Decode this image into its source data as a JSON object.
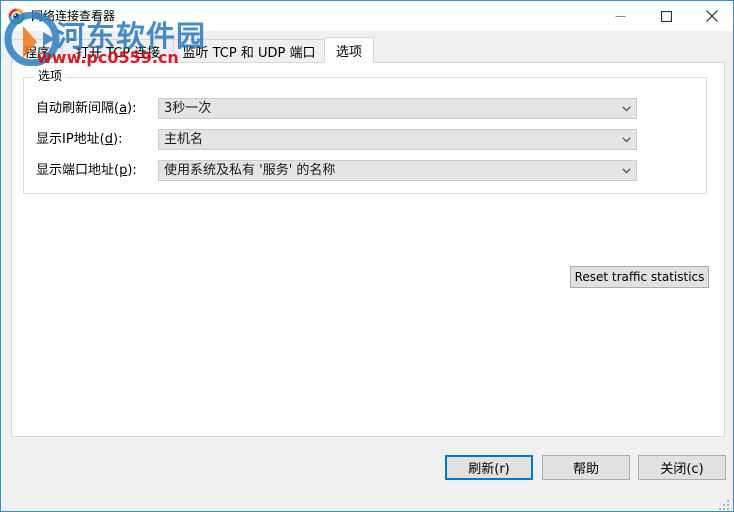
{
  "window": {
    "title": "网络连接查看器",
    "icon": "eye-globe-icon",
    "controls": {
      "minimize": "minimize-icon",
      "maximize": "maximize-icon",
      "close": "close-icon"
    },
    "accent_color": "#2d8fcc",
    "focus_color": "#0078d7"
  },
  "tabs": [
    {
      "label": "程序",
      "active": false
    },
    {
      "label": "打开 TCP 连接",
      "active": false
    },
    {
      "label": "监听 TCP 和 UDP 端口",
      "active": false
    },
    {
      "label": "选项",
      "active": true
    }
  ],
  "options_group": {
    "legend": "选项",
    "fields": [
      {
        "label_pre": "自动刷新间隔(",
        "label_key": "a",
        "label_post": "):",
        "value": "3秒一次",
        "arrow": "chevron-down-icon"
      },
      {
        "label_pre": "显示IP地址(",
        "label_key": "d",
        "label_post": "):",
        "value": "主机名",
        "arrow": "chevron-down-icon"
      },
      {
        "label_pre": "显示端口地址(",
        "label_key": "p",
        "label_post": "):",
        "value": "使用系统及私有 '服务' 的名称",
        "arrow": "chevron-down-icon"
      }
    ]
  },
  "reset_button": {
    "label": "Reset traffic statistics"
  },
  "footer_buttons": [
    {
      "label": "刷新(r)",
      "focused": true
    },
    {
      "label": "帮助",
      "focused": false
    },
    {
      "label": "关闭(c)",
      "focused": false
    }
  ],
  "watermark": {
    "text": "河东软件园",
    "url": "www.pc0559.cn",
    "text_color": "#1e73be",
    "url_color": "#d00b14"
  }
}
